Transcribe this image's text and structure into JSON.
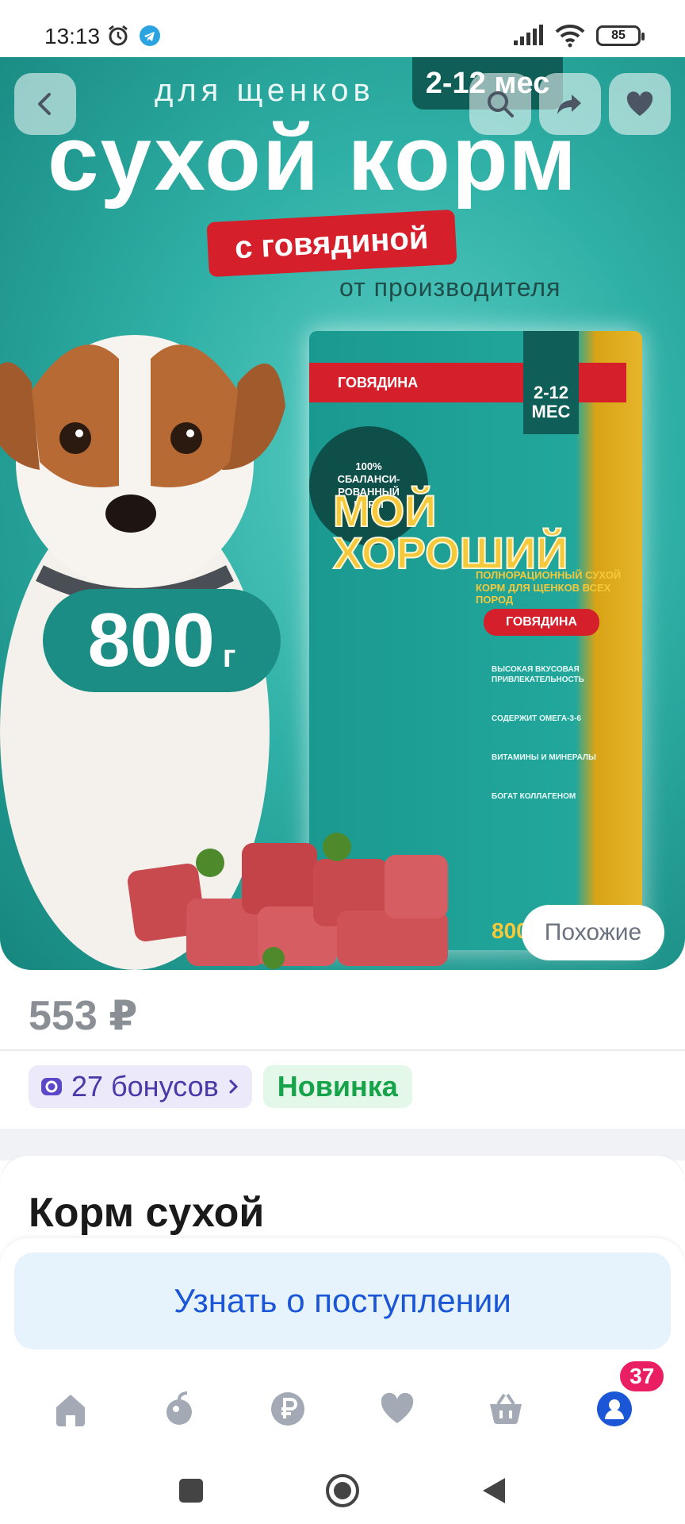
{
  "status_bar": {
    "time": "13:13",
    "battery": "85",
    "icons": [
      "alarm-icon",
      "telegram-icon",
      "signal-icon",
      "wifi-icon",
      "battery-icon"
    ]
  },
  "hero": {
    "subtitle": "для щенков",
    "age_badge": "2-12 мес",
    "title": "сухой корм",
    "tag": "с говядиной",
    "from_label": "от производителя",
    "weight_value": "800",
    "weight_unit": "г",
    "package": {
      "band": "ГОВЯДИНА",
      "age": "2-12 МЕС",
      "circle": "100% СБАЛАНСИ-РОВАННЫЙ КОРМ",
      "brand_line1": "МОЙ",
      "brand_line2": "ХОРОШИЙ",
      "desc": "ПОЛНОРАЦИОННЫЙ СУХОЙ КОРМ ДЛЯ ЩЕНКОВ ВСЕХ ПОРОД",
      "meat_label": "ГОВЯДИНА",
      "features": [
        "ВЫСОКАЯ ВКУСОВАЯ ПРИВЛЕКАТЕЛЬНОСТЬ",
        "СОДЕРЖИТ ОМЕГА-3-6",
        "ВИТАМИНЫ И МИНЕРАЛЫ",
        "БОГАТ КОЛЛАГЕНОМ"
      ],
      "weight": "800 г"
    },
    "similar_label": "Похожие"
  },
  "product": {
    "price": "553 ₽",
    "bonus_label": "27 бонусов",
    "new_label": "Новинка",
    "title": "Корм сухой"
  },
  "actions": {
    "notify_label": "Узнать о поступлении"
  },
  "tabbar": {
    "items": [
      "home-icon",
      "catalog-icon",
      "payments-icon",
      "favorites-icon",
      "cart-icon",
      "profile-icon"
    ],
    "profile_badge": "37"
  },
  "colors": {
    "accent_blue": "#1a56d6",
    "badge_pink": "#ea1f63",
    "bonus_purple": "#4a3aa8",
    "new_green": "#17a34a",
    "hero_teal": "#2fb0a6"
  }
}
